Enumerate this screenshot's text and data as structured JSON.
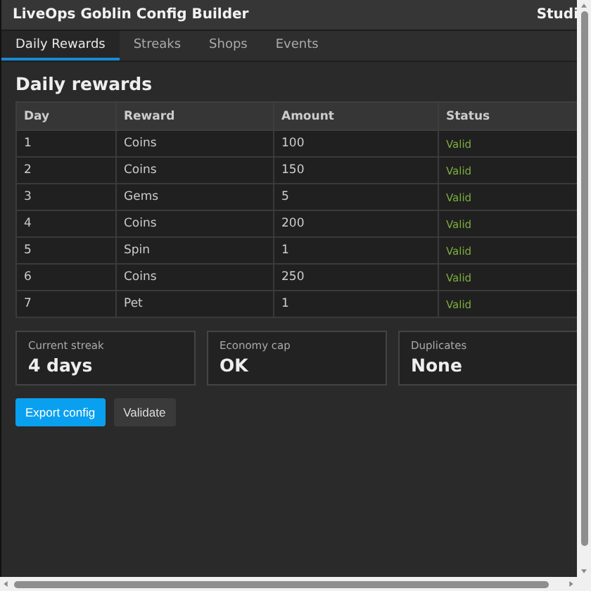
{
  "window": {
    "title": "LiveOps Goblin Config Builder",
    "workspace": "Studi"
  },
  "tabs": [
    {
      "label": "Daily Rewards",
      "selected": true
    },
    {
      "label": "Streaks",
      "selected": false
    },
    {
      "label": "Shops",
      "selected": false
    },
    {
      "label": "Events",
      "selected": false
    }
  ],
  "heading": "Daily rewards",
  "table": {
    "columns": [
      "Day",
      "Reward",
      "Amount",
      "Status"
    ],
    "rows": [
      [
        "1",
        "Coins",
        "100",
        "Valid"
      ],
      [
        "2",
        "Coins",
        "150",
        "Valid"
      ],
      [
        "3",
        "Gems",
        "5",
        "Valid"
      ],
      [
        "4",
        "Coins",
        "200",
        "Valid"
      ],
      [
        "5",
        "Spin",
        "1",
        "Valid"
      ],
      [
        "6",
        "Coins",
        "250",
        "Valid"
      ],
      [
        "7",
        "Pet",
        "1",
        "Valid"
      ]
    ]
  },
  "stats": [
    {
      "label": "Current streak",
      "value": "4 days"
    },
    {
      "label": "Economy cap",
      "value": "OK"
    },
    {
      "label": "Duplicates",
      "value": "None"
    }
  ],
  "buttons": [
    {
      "label": "Export config",
      "kind": "primary"
    },
    {
      "label": "Validate",
      "kind": "secondary"
    }
  ]
}
